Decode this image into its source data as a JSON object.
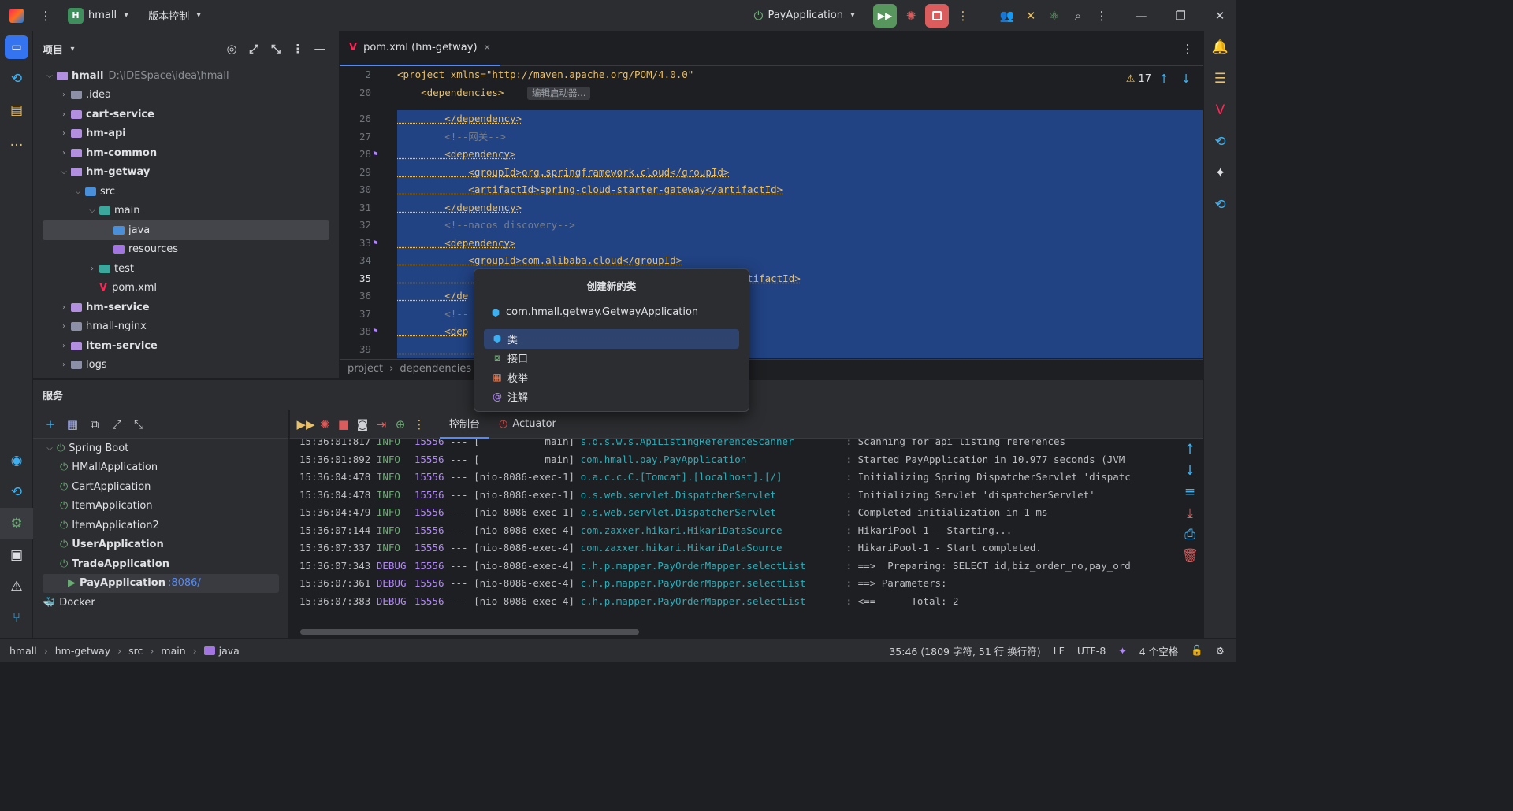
{
  "titlebar": {
    "project": "hmall",
    "project_badge": "H",
    "vcs": "版本控制",
    "run_config": "PayApplication"
  },
  "project_panel": {
    "title": "项目",
    "tree": [
      {
        "label": "hmall",
        "extra": "D:\\IDESpace\\idea\\hmall",
        "depth": 0,
        "open": true,
        "bold": true
      },
      {
        "label": ".idea",
        "depth": 1,
        "open": false
      },
      {
        "label": "cart-service",
        "depth": 1,
        "open": false,
        "bold": true
      },
      {
        "label": "hm-api",
        "depth": 1,
        "open": false,
        "bold": true
      },
      {
        "label": "hm-common",
        "depth": 1,
        "open": false,
        "bold": true
      },
      {
        "label": "hm-getway",
        "depth": 1,
        "open": true,
        "bold": true
      },
      {
        "label": "src",
        "depth": 2,
        "open": true
      },
      {
        "label": "main",
        "depth": 3,
        "open": true
      },
      {
        "label": "java",
        "depth": 4,
        "selected": true
      },
      {
        "label": "resources",
        "depth": 4
      },
      {
        "label": "test",
        "depth": 3,
        "open": false
      },
      {
        "label": "pom.xml",
        "depth": 3
      },
      {
        "label": "hm-service",
        "depth": 1,
        "open": false,
        "bold": true
      },
      {
        "label": "hmall-nginx",
        "depth": 1,
        "open": false
      },
      {
        "label": "item-service",
        "depth": 1,
        "open": false,
        "bold": true
      },
      {
        "label": "logs",
        "depth": 1,
        "open": false
      }
    ]
  },
  "editor": {
    "tab": "pom.xml (hm-getway)",
    "warnings": "17",
    "sticky_lines": [
      {
        "ln": "2",
        "code": "<project xmlns=\"http://maven.apache.org/POM/4.0.0\""
      },
      {
        "ln": "20",
        "code": "    <dependencies>",
        "hint": "编辑启动器..."
      }
    ],
    "lines": [
      {
        "ln": "26",
        "code": "        </dependency>",
        "kind": "tag"
      },
      {
        "ln": "27",
        "code": "        <!--网关-->",
        "kind": "cmt"
      },
      {
        "ln": "28",
        "code": "        <dependency>",
        "kind": "tag"
      },
      {
        "ln": "29",
        "code": "            <groupId>org.springframework.cloud</groupId>",
        "kind": "tag"
      },
      {
        "ln": "30",
        "code": "            <artifactId>spring-cloud-starter-gateway</artifactId>",
        "kind": "tag"
      },
      {
        "ln": "31",
        "code": "        </dependency>",
        "kind": "tag"
      },
      {
        "ln": "32",
        "code": "        <!--nacos discovery-->",
        "kind": "cmt"
      },
      {
        "ln": "33",
        "code": "        <dependency>",
        "kind": "tag"
      },
      {
        "ln": "34",
        "code": "            <groupId>com.alibaba.cloud</groupId>",
        "kind": "tag"
      },
      {
        "ln": "35",
        "code": "                                          cos-discovery</artifactId>",
        "kind": "tag"
      },
      {
        "ln": "36",
        "code": "        </de",
        "kind": "tag"
      },
      {
        "ln": "37",
        "code": "        <!--",
        "kind": "cmt"
      },
      {
        "ln": "38",
        "code": "        <dep",
        "kind": "tag"
      },
      {
        "ln": "39",
        "code": "                                                  >",
        "kind": "tag"
      }
    ],
    "breadcrumb": [
      "project",
      "dependencies"
    ]
  },
  "popup": {
    "title": "创建新的类",
    "input_value": "com.hmall.getway.GetwayApplication",
    "items": [
      "类",
      "接口",
      "枚举",
      "注解"
    ]
  },
  "services": {
    "title": "服务",
    "tree": [
      {
        "label": "Spring Boot",
        "depth": 0
      },
      {
        "label": "HMallApplication",
        "depth": 1
      },
      {
        "label": "CartApplication",
        "depth": 1
      },
      {
        "label": "ItemApplication",
        "depth": 1
      },
      {
        "label": "ItemApplication2",
        "depth": 1
      },
      {
        "label": "UserApplication",
        "depth": 1,
        "bold": true
      },
      {
        "label": "TradeApplication",
        "depth": 1,
        "bold": true
      },
      {
        "label": "PayApplication",
        "port": ":8086/",
        "depth": 1,
        "bold": true,
        "running": true
      },
      {
        "label": "Docker",
        "depth": 0
      }
    ],
    "console_tabs": [
      "控制台",
      "Actuator"
    ],
    "logs": [
      {
        "time": "15:36:01:817",
        "level": "INFO",
        "pid": "15556",
        "thread": "[           main]",
        "logger": "s.d.s.w.s.ApiListingReferenceScanner",
        "msg": ": Scanning for api listing references"
      },
      {
        "time": "15:36:01:892",
        "level": "INFO",
        "pid": "15556",
        "thread": "[           main]",
        "logger": "com.hmall.pay.PayApplication",
        "msg": ": Started PayApplication in 10.977 seconds (JVM"
      },
      {
        "time": "15:36:04:478",
        "level": "INFO",
        "pid": "15556",
        "thread": "[nio-8086-exec-1]",
        "logger": "o.a.c.c.C.[Tomcat].[localhost].[/]",
        "msg": ": Initializing Spring DispatcherServlet 'dispatc"
      },
      {
        "time": "15:36:04:478",
        "level": "INFO",
        "pid": "15556",
        "thread": "[nio-8086-exec-1]",
        "logger": "o.s.web.servlet.DispatcherServlet",
        "msg": ": Initializing Servlet 'dispatcherServlet'"
      },
      {
        "time": "15:36:04:479",
        "level": "INFO",
        "pid": "15556",
        "thread": "[nio-8086-exec-1]",
        "logger": "o.s.web.servlet.DispatcherServlet",
        "msg": ": Completed initialization in 1 ms"
      },
      {
        "time": "15:36:07:144",
        "level": "INFO",
        "pid": "15556",
        "thread": "[nio-8086-exec-4]",
        "logger": "com.zaxxer.hikari.HikariDataSource",
        "msg": ": HikariPool-1 - Starting..."
      },
      {
        "time": "15:36:07:337",
        "level": "INFO",
        "pid": "15556",
        "thread": "[nio-8086-exec-4]",
        "logger": "com.zaxxer.hikari.HikariDataSource",
        "msg": ": HikariPool-1 - Start completed."
      },
      {
        "time": "15:36:07:343",
        "level": "DEBUG",
        "pid": "15556",
        "thread": "[nio-8086-exec-4]",
        "logger": "c.h.p.mapper.PayOrderMapper.selectList",
        "msg": ": ==>  Preparing: SELECT id,biz_order_no,pay_ord"
      },
      {
        "time": "15:36:07:361",
        "level": "DEBUG",
        "pid": "15556",
        "thread": "[nio-8086-exec-4]",
        "logger": "c.h.p.mapper.PayOrderMapper.selectList",
        "msg": ": ==> Parameters:"
      },
      {
        "time": "15:36:07:383",
        "level": "DEBUG",
        "pid": "15556",
        "thread": "[nio-8086-exec-4]",
        "logger": "c.h.p.mapper.PayOrderMapper.selectList",
        "msg": ": <==      Total: 2"
      }
    ]
  },
  "statusbar": {
    "path": [
      "hmall",
      "hm-getway",
      "src",
      "main",
      "java"
    ],
    "position": "35:46 (1809 字符, 51 行 换行符)",
    "line_sep": "LF",
    "encoding": "UTF-8",
    "indent": "4 个空格"
  },
  "colors": {
    "accent": "#548af7",
    "selection": "#214283",
    "run": "#57965c",
    "stop": "#db5c5c"
  }
}
